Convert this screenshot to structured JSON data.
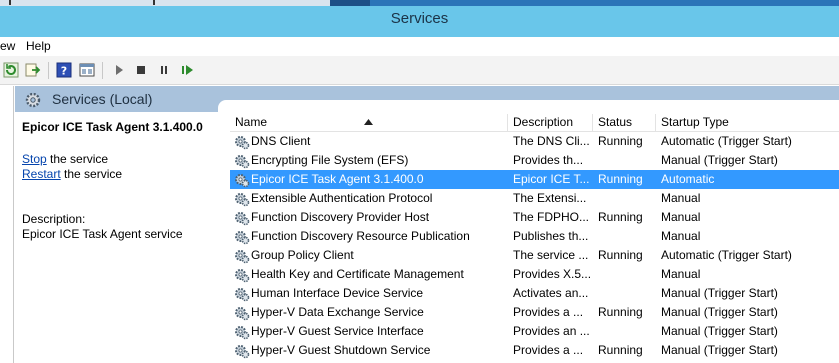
{
  "window": {
    "title": "Services"
  },
  "menu": {
    "items": [
      {
        "label": "ew"
      },
      {
        "label": "Help"
      }
    ]
  },
  "toolbar": {
    "buttons": [
      {
        "icon": "refresh-icon"
      },
      {
        "icon": "export-list-icon"
      },
      {
        "icon": "help-icon"
      },
      {
        "icon": "show-hide-pane-icon"
      },
      {
        "icon": "start-service-icon"
      },
      {
        "icon": "stop-service-icon"
      },
      {
        "icon": "pause-service-icon"
      },
      {
        "icon": "resume-service-icon"
      }
    ]
  },
  "header": {
    "label": "Services (Local)"
  },
  "description_pane": {
    "service_title": "Epicor ICE Task Agent 3.1.400.0",
    "stop_link": "Stop",
    "stop_suffix": " the service",
    "restart_link": "Restart",
    "restart_suffix": " the service",
    "description_label": "Description:",
    "description_text": "Epicor ICE Task Agent service"
  },
  "columns": {
    "name": "Name",
    "description": "Description",
    "status": "Status",
    "startup": "Startup Type"
  },
  "rows": [
    {
      "name": "DNS Client",
      "description": "The DNS Cli...",
      "status": "Running",
      "startup": "Automatic (Trigger Start)",
      "selected": false
    },
    {
      "name": "Encrypting File System (EFS)",
      "description": "Provides th...",
      "status": "",
      "startup": "Manual (Trigger Start)",
      "selected": false
    },
    {
      "name": "Epicor ICE Task Agent 3.1.400.0",
      "description": "Epicor ICE T...",
      "status": "Running",
      "startup": "Automatic",
      "selected": true
    },
    {
      "name": "Extensible Authentication Protocol",
      "description": "The Extensi...",
      "status": "",
      "startup": "Manual",
      "selected": false
    },
    {
      "name": "Function Discovery Provider Host",
      "description": "The FDPHO...",
      "status": "Running",
      "startup": "Manual",
      "selected": false
    },
    {
      "name": "Function Discovery Resource Publication",
      "description": "Publishes th...",
      "status": "",
      "startup": "Manual",
      "selected": false
    },
    {
      "name": "Group Policy Client",
      "description": "The service ...",
      "status": "Running",
      "startup": "Automatic (Trigger Start)",
      "selected": false
    },
    {
      "name": "Health Key and Certificate Management",
      "description": "Provides X.5...",
      "status": "",
      "startup": "Manual",
      "selected": false
    },
    {
      "name": "Human Interface Device Service",
      "description": "Activates an...",
      "status": "",
      "startup": "Manual (Trigger Start)",
      "selected": false
    },
    {
      "name": "Hyper-V Data Exchange Service",
      "description": "Provides a ...",
      "status": "Running",
      "startup": "Manual (Trigger Start)",
      "selected": false
    },
    {
      "name": "Hyper-V Guest Service Interface",
      "description": "Provides an ...",
      "status": "",
      "startup": "Manual (Trigger Start)",
      "selected": false
    },
    {
      "name": "Hyper-V Guest Shutdown Service",
      "description": "Provides a ...",
      "status": "Running",
      "startup": "Manual (Trigger Start)",
      "selected": false
    }
  ],
  "colors": {
    "titlebar": "#69c6ea",
    "header_band": "#a9c2dc",
    "selection": "#3399ff",
    "link": "#0645ad"
  }
}
